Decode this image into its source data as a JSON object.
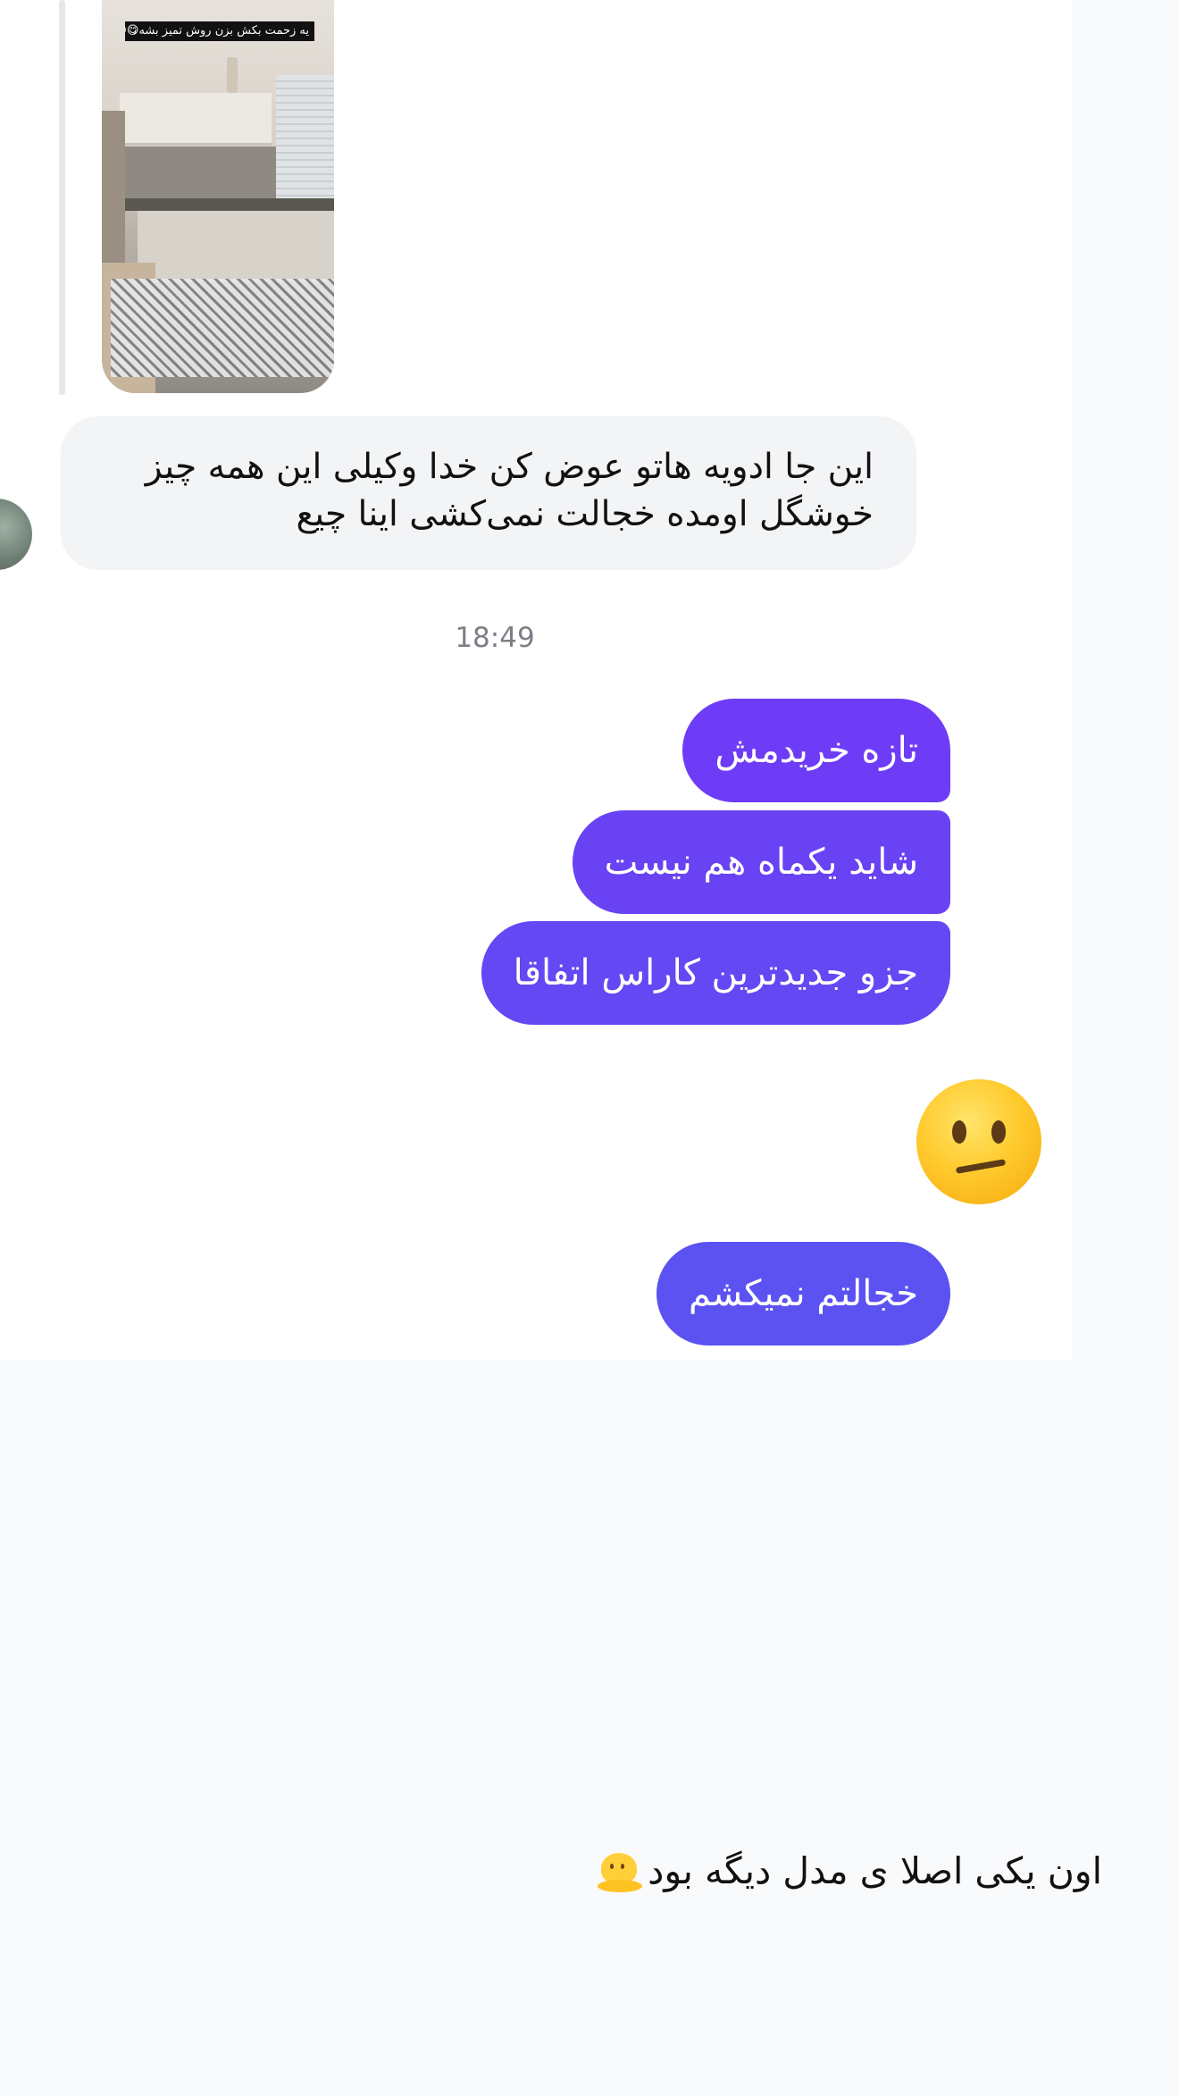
{
  "story": {
    "sticker_text": "یه زحمت بکش بزن روش تمیز بشه😋😊"
  },
  "messages": {
    "incoming": {
      "lines": [
        "این جا ادویه هاتو عوض کن خدا وکیلی این همه چیز",
        "خوشگل اومده خجالت نمی‌کشی اینا چیع"
      ]
    },
    "timestamp": "18:49",
    "outgoing": [
      "تازه خریدمش",
      "شاید یکماه هم نیست",
      "جزو جدیدترین کاراس اتفاقا"
    ],
    "emoji": "confused-face",
    "last_outgoing": "خجالتم نمیکشم"
  },
  "caption": {
    "text": "اون یکی اصلا ی مدل دیگه بود",
    "icon": "melting-face-icon"
  },
  "colors": {
    "outgoing_bubble": "#6c3ff5",
    "incoming_bubble": "#f2f4f6",
    "timestamp": "#7b7f86",
    "background": "#f9fafc"
  }
}
